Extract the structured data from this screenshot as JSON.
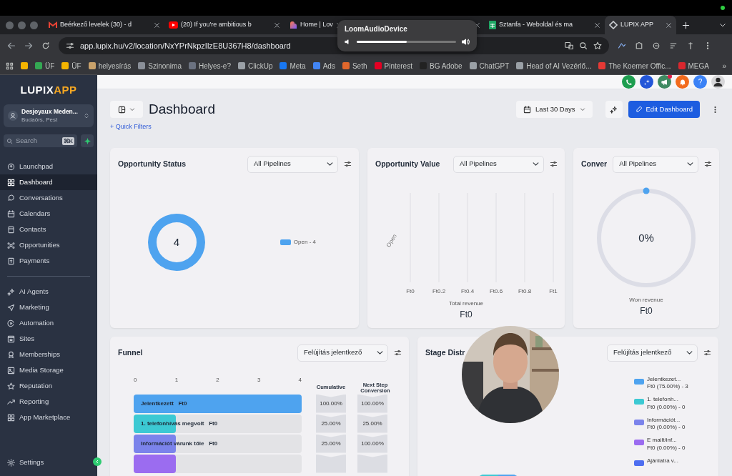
{
  "browser": {
    "tabs": [
      {
        "title": "Beérkező levelek (30) - d",
        "kind": "mail",
        "selected": false
      },
      {
        "title": "(20) If you're ambitious b",
        "kind": "video",
        "selected": false
      },
      {
        "title": "Home | Lov",
        "kind": "gradient",
        "selected": false
      },
      {
        "selected": false
      },
      {
        "title": "Sztanfa - Weboldal és ma",
        "kind": "sheet",
        "selected": false
      },
      {
        "title": "LUPIX APP",
        "kind": "app",
        "selected": true
      }
    ],
    "loom": {
      "title": "LoomAudioDevice",
      "level": 0.5
    },
    "url": "app.lupix.hu/v2/location/NxYPrNkpzIlzE8U367H8/dashboard",
    "bookmarks": [
      {
        "color": "#f4b400"
      },
      {
        "label": "ÜF",
        "color": "#34a853"
      },
      {
        "label": "ÜF",
        "color": "#f4b400"
      },
      {
        "label": "helyesírás",
        "color": "#c9a26b"
      },
      {
        "label": "Szinonima",
        "color": "#8a8f98"
      },
      {
        "label": "Helyes-e?",
        "color": "#6b7280"
      },
      {
        "label": "ClickUp",
        "color": "#9aa0a6"
      },
      {
        "label": "Meta",
        "color": "#1877f2"
      },
      {
        "label": "Ads",
        "color": "#4285f4"
      },
      {
        "label": "Seth",
        "color": "#e0672c"
      },
      {
        "label": "Pinterest",
        "color": "#e60023"
      },
      {
        "label": "BG Adobe",
        "color": "#222222"
      },
      {
        "label": "ChatGPT",
        "color": "#9aa0a6"
      },
      {
        "label": "Head of AI Vezérlő...",
        "color": "#9aa0a6"
      },
      {
        "label": "The Koerner Offic...",
        "color": "#e53935"
      },
      {
        "label": "MEGA",
        "color": "#d9272e"
      }
    ],
    "more": "»"
  },
  "sidebar": {
    "logo": {
      "first": "LUPIX",
      "second": "APP"
    },
    "account": {
      "name": "Desjoyaux Meden...",
      "location": "Budaörs, Pest"
    },
    "search": {
      "placeholder": "Search",
      "shortcut": "⌘K"
    },
    "main_items": [
      {
        "label": "Launchpad",
        "selected": false
      },
      {
        "label": "Dashboard",
        "selected": true
      },
      {
        "label": "Conversations",
        "selected": false
      },
      {
        "label": "Calendars",
        "selected": false
      },
      {
        "label": "Contacts",
        "selected": false
      },
      {
        "label": "Opportunities",
        "selected": false
      },
      {
        "label": "Payments",
        "selected": false
      }
    ],
    "tool_items": [
      {
        "label": "AI Agents",
        "selected": false
      },
      {
        "label": "Marketing",
        "selected": false
      },
      {
        "label": "Automation",
        "selected": false
      },
      {
        "label": "Sites",
        "selected": false
      },
      {
        "label": "Memberships",
        "selected": false
      },
      {
        "label": "Media Storage",
        "selected": false
      },
      {
        "label": "Reputation",
        "selected": false
      },
      {
        "label": "Reporting",
        "selected": false
      },
      {
        "label": "App Marketplace",
        "selected": false
      }
    ],
    "settings": "Settings"
  },
  "header_buttons": [
    {
      "color": "#1e9e4f",
      "notification": false
    },
    {
      "color": "#2356d8",
      "notification": false
    },
    {
      "color": "#3f8a62",
      "notification": true
    },
    {
      "color": "#f26b1d",
      "notification": false
    },
    {
      "color": "#3b82f6",
      "notification": false,
      "label": "?"
    }
  ],
  "page": {
    "title": "Dashboard",
    "date_range": "Last 30 Days",
    "edit_button": "Edit Dashboard",
    "quick_filters": "+ Quick Filters"
  },
  "opportunity_status": {
    "title": "Opportunity Status",
    "filter": "All Pipelines",
    "center": "4",
    "legend": "Open - 4",
    "color": "#4ea3ef"
  },
  "opportunity_value": {
    "title": "Opportunity Value",
    "filter": "All Pipelines",
    "row_label": "Open",
    "axis": [
      "Ft0",
      "Ft0.2",
      "Ft0.4",
      "Ft0.6",
      "Ft0.8",
      "Ft1"
    ],
    "axis_title": "Total revenue",
    "total": "Ft0"
  },
  "conversion": {
    "title": "Conver",
    "filter": "All Pipelines",
    "percent": "0%",
    "caption": "Won revenue",
    "total": "Ft0"
  },
  "funnel": {
    "title": "Funnel",
    "filter": "Felújítás jelentkező",
    "axis": [
      "0",
      "1",
      "2",
      "3",
      "4"
    ],
    "cumulative_header": "Cumulative",
    "next_header": "Next Step Conversion",
    "rows": [
      {
        "label": "Jelentkezett",
        "amount": "Ft0",
        "level": 1,
        "color": "#4ea3ef",
        "cumulative": "100.00%",
        "next": "100.00%"
      },
      {
        "label": "1. telefonhívás megvolt",
        "amount": "Ft0",
        "level": 0.25,
        "color": "#3cc9d3",
        "cumulative": "25.00%",
        "next": "25.00%"
      },
      {
        "label": "Információt várunk tőle",
        "amount": "Ft0",
        "level": 0.25,
        "color": "#7b83eb",
        "cumulative": "25.00%",
        "next": "100.00%"
      },
      {
        "level": 0.25,
        "color": "#9b6cf0"
      }
    ]
  },
  "stage_distribution": {
    "title": "Stage Distr",
    "filter": "Felújítás jelentkező",
    "legend": [
      {
        "name": "Jelentkezet...",
        "detail": "Ft0 (75.00%) - 3",
        "color": "#4ea3ef"
      },
      {
        "name": "1. telefonh...",
        "detail": "Ft0 (0.00%) - 0",
        "color": "#3cc9d3"
      },
      {
        "name": "Információt...",
        "detail": "Ft0 (0.00%) - 0",
        "color": "#7b83eb"
      },
      {
        "name": "E mailt/inf...",
        "detail": "Ft0 (0.00%) - 0",
        "color": "#9b6cf0"
      },
      {
        "name": "Ajánlatra v...",
        "color": "#4e6ef0"
      }
    ]
  }
}
